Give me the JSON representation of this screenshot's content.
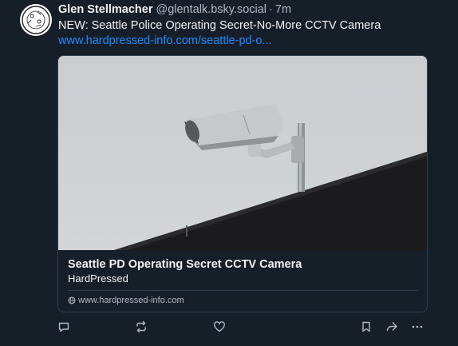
{
  "post": {
    "author_name": "Glen Stellmacher",
    "author_handle": "@glentalk.bsky.social",
    "separator": "·",
    "timestamp": "7m",
    "text": "NEW: Seattle Police Operating Secret-No-More CCTV Camera",
    "link_text": "www.hardpressed-info.com/seattle-pd-o..."
  },
  "card": {
    "image_subject": "security camera mounted on building roof edge",
    "title": "Seattle PD Operating Secret CCTV Camera",
    "description": "HardPressed",
    "domain": "www.hardpressed-info.com"
  },
  "actions": {
    "icons": [
      "reply-icon",
      "repost-icon",
      "like-icon",
      "bookmark-icon",
      "share-icon",
      "more-icon"
    ]
  },
  "colors": {
    "background": "#161e27",
    "text": "#f1f3f5",
    "muted": "#aebbc9",
    "link": "#208bfe",
    "border": "#2e4052"
  }
}
